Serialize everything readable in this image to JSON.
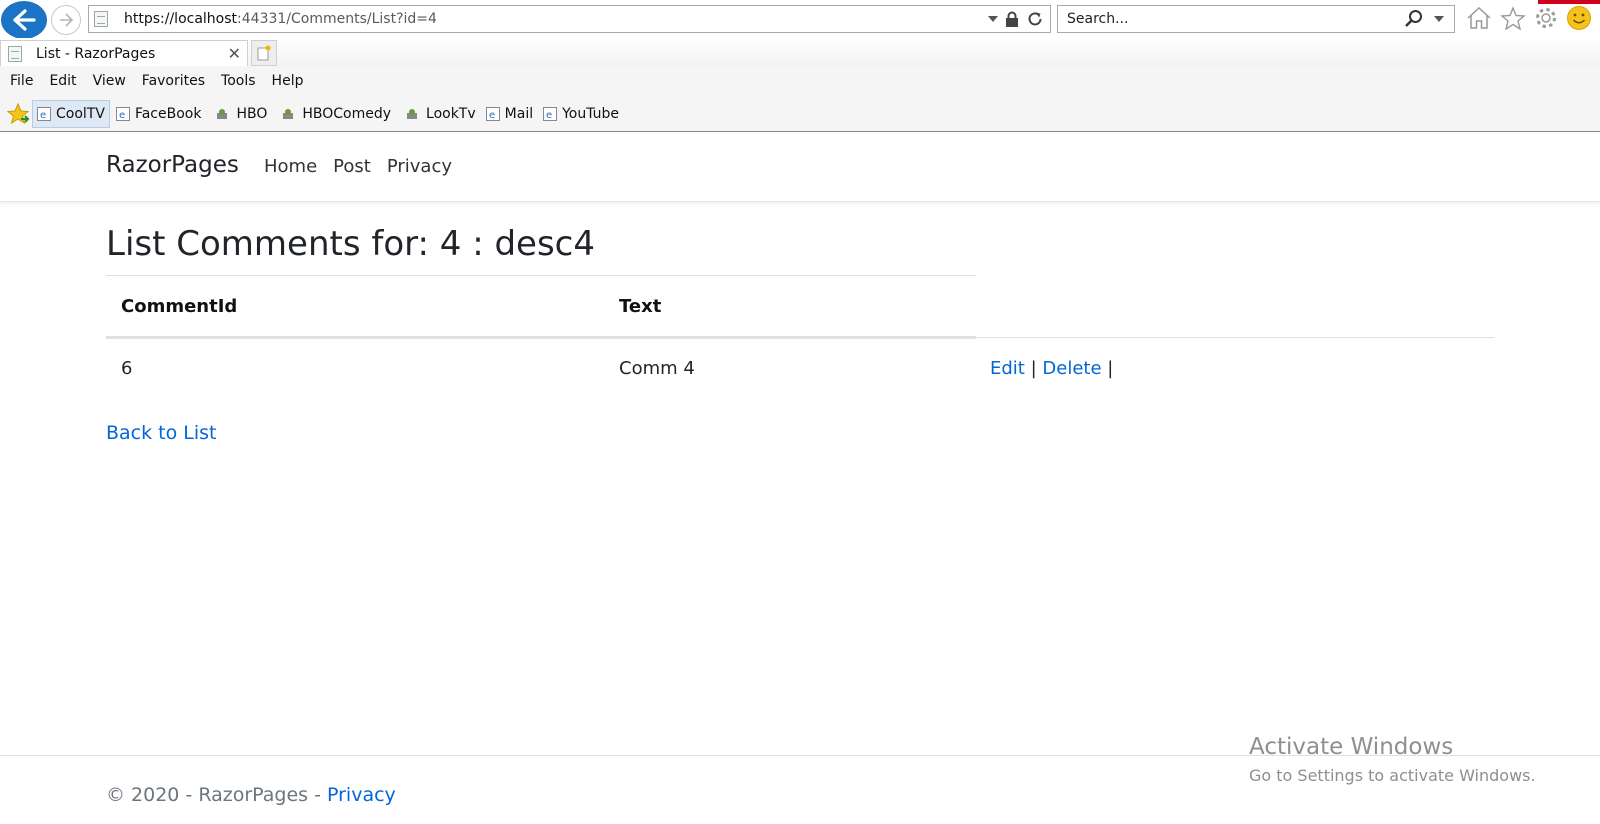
{
  "browser": {
    "url_host": "https://localhost",
    "url_rest": ":44331/Comments/List?id=4",
    "search_placeholder": "Search...",
    "tab_title": "List - RazorPages",
    "menu": [
      "File",
      "Edit",
      "View",
      "Favorites",
      "Tools",
      "Help"
    ],
    "favorites": [
      "CoolTV",
      "FaceBook",
      "HBO",
      "HBOComedy",
      "LookTv",
      "Mail",
      "YouTube"
    ]
  },
  "nav": {
    "brand": "RazorPages",
    "links": [
      "Home",
      "Post",
      "Privacy"
    ]
  },
  "page": {
    "heading": "List Comments for: 4 : desc4",
    "columns": [
      "CommentId",
      "Text"
    ],
    "rows": [
      {
        "id": "6",
        "text": "Comm 4",
        "edit": "Edit",
        "delete": "Delete",
        "sep": "|"
      }
    ],
    "back_link": "Back to List"
  },
  "footer": {
    "text": "© 2020 - RazorPages - ",
    "privacy": "Privacy"
  },
  "watermark": {
    "title": "Activate Windows",
    "subtitle": "Go to Settings to activate Windows."
  }
}
